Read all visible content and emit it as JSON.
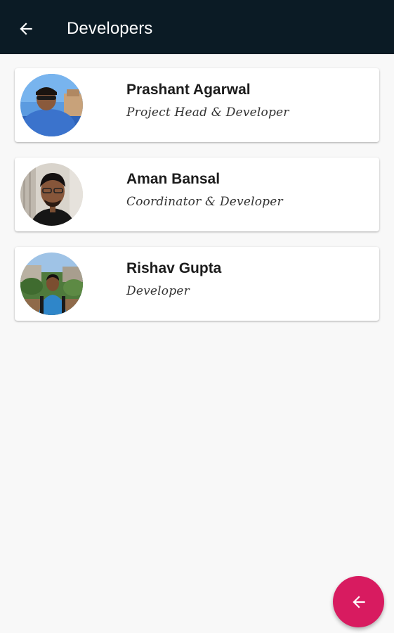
{
  "appbar": {
    "title": "Developers",
    "back_icon": "arrow-back-icon",
    "background": "#0b1b25"
  },
  "developers": [
    {
      "name": "Prashant Agarwal",
      "role": "Project Head & Developer"
    },
    {
      "name": "Aman Bansal",
      "role": "Coordinator & Developer"
    },
    {
      "name": "Rishav Gupta",
      "role": "Developer"
    }
  ],
  "fab": {
    "icon": "arrow-back-icon",
    "color": "#d81b60"
  }
}
